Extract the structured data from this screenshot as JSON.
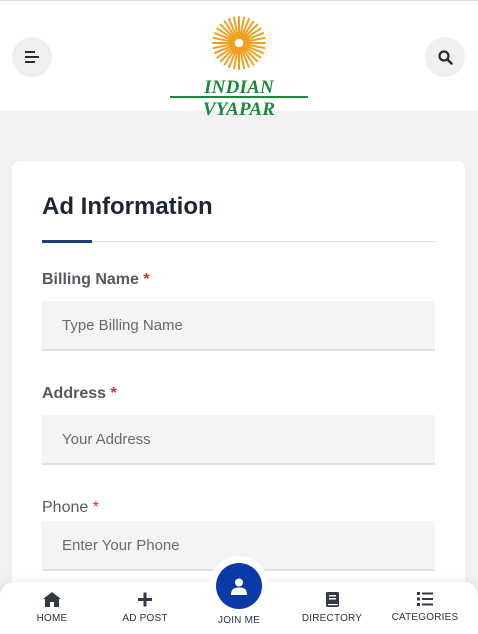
{
  "header": {
    "brand_name": "INDIAN VYAPAR",
    "menu_icon": "menu-lines-icon",
    "search_icon": "search-icon",
    "brand_color": "#1a8a3a",
    "sun_color": "#f0a020"
  },
  "form": {
    "title": "Ad Information",
    "billing_name": {
      "label": "Billing Name",
      "required_mark": "*",
      "placeholder": "Type Billing Name",
      "value": ""
    },
    "address": {
      "label": "Address",
      "required_mark": "*",
      "placeholder": "Your Address",
      "value": ""
    },
    "phone": {
      "label": "Phone",
      "required_mark": "*",
      "placeholder": "Enter Your Phone",
      "value": ""
    }
  },
  "bottom_nav": {
    "home": {
      "label": "HOME",
      "icon": "home-icon"
    },
    "ad_post": {
      "label": "AD POST",
      "icon": "plus-icon"
    },
    "join_me": {
      "label": "JOIN ME",
      "icon": "user-icon"
    },
    "directory": {
      "label": "DIRECTORY",
      "icon": "book-icon"
    },
    "categories": {
      "label": "CATEGORIES",
      "icon": "list-icon"
    }
  },
  "colors": {
    "accent": "#1d3f72",
    "join_button": "#0a3aa8",
    "required": "#d23030"
  }
}
